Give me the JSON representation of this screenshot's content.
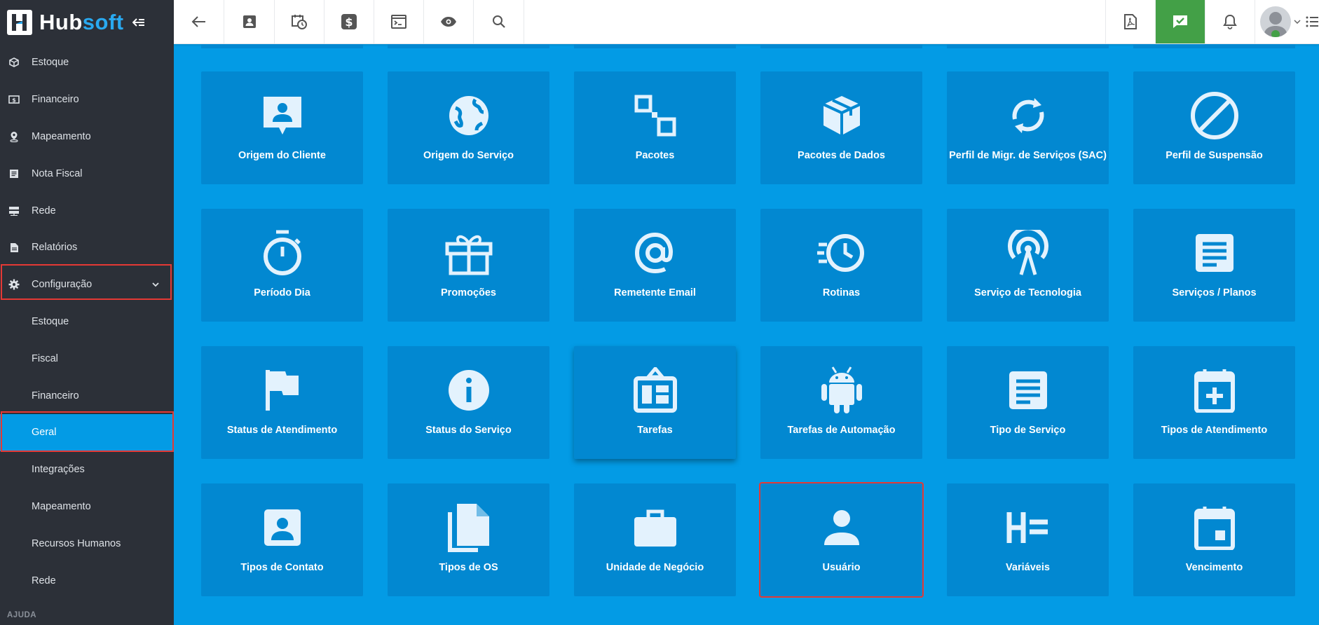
{
  "app": {
    "name_part1": "Hub",
    "name_part2": "soft"
  },
  "sidebar": {
    "items": [
      {
        "label": "Estoque",
        "icon": "box-icon"
      },
      {
        "label": "Financeiro",
        "icon": "money-icon"
      },
      {
        "label": "Mapeamento",
        "icon": "map-pin-icon"
      },
      {
        "label": "Nota Fiscal",
        "icon": "receipt-icon"
      },
      {
        "label": "Rede",
        "icon": "server-icon"
      },
      {
        "label": "Relatórios",
        "icon": "document-icon"
      },
      {
        "label": "Configuração",
        "icon": "gear-icon"
      }
    ],
    "subitems": [
      {
        "label": "Estoque"
      },
      {
        "label": "Fiscal"
      },
      {
        "label": "Financeiro"
      },
      {
        "label": "Geral"
      },
      {
        "label": "Integrações"
      },
      {
        "label": "Mapeamento"
      },
      {
        "label": "Recursos Humanos"
      },
      {
        "label": "Rede"
      }
    ],
    "section_label": "AJUDA"
  },
  "tiles": [
    {
      "label": "Origem do Cliente",
      "icon": "contact-chat-icon"
    },
    {
      "label": "Origem do Serviço",
      "icon": "globe-icon"
    },
    {
      "label": "Pacotes",
      "icon": "squares-icon"
    },
    {
      "label": "Pacotes de Dados",
      "icon": "package-icon"
    },
    {
      "label": "Perfil de Migr. de Serviços (SAC)",
      "icon": "sync-icon"
    },
    {
      "label": "Perfil de Suspensão",
      "icon": "block-icon"
    },
    {
      "label": "Período Dia",
      "icon": "timer-icon"
    },
    {
      "label": "Promoções",
      "icon": "gift-icon"
    },
    {
      "label": "Remetente Email",
      "icon": "at-icon"
    },
    {
      "label": "Rotinas",
      "icon": "history-icon"
    },
    {
      "label": "Serviço de Tecnologia",
      "icon": "antenna-icon"
    },
    {
      "label": "Serviços / Planos",
      "icon": "doc-lines-icon"
    },
    {
      "label": "Status de Atendimento",
      "icon": "flag-icon"
    },
    {
      "label": "Status do Serviço",
      "icon": "info-icon"
    },
    {
      "label": "Tarefas",
      "icon": "task-board-icon"
    },
    {
      "label": "Tarefas de Automação",
      "icon": "android-icon"
    },
    {
      "label": "Tipo de Serviço",
      "icon": "doc-lines-icon"
    },
    {
      "label": "Tipos de Atendimento",
      "icon": "calendar-plus-icon"
    },
    {
      "label": "Tipos de Contato",
      "icon": "contact-card-icon"
    },
    {
      "label": "Tipos de OS",
      "icon": "files-icon"
    },
    {
      "label": "Unidade de Negócio",
      "icon": "briefcase-icon"
    },
    {
      "label": "Usuário",
      "icon": "user-icon"
    },
    {
      "label": "Variáveis",
      "icon": "variables-icon"
    },
    {
      "label": "Vencimento",
      "icon": "calendar-icon"
    }
  ]
}
